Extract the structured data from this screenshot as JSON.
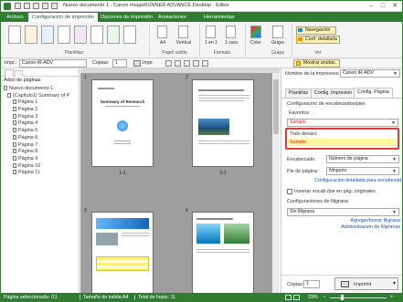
{
  "window": {
    "title": "Nuevo documento 1 - Canon imageRUNNER ADVANCE Desktop - Editor",
    "controls": [
      "–",
      "□",
      "✕"
    ]
  },
  "ribbon": {
    "tabs": [
      "Archivo",
      "Configuración de impresión",
      "Opciones de impresión",
      "Anotaciones",
      "Herramientas"
    ],
    "active_tab": 1,
    "groups": {
      "plantillas": "Plantillas",
      "papel_salida": "Papel salida",
      "formato": "Formato",
      "grapa": "Grapa",
      "ver": "Ver"
    },
    "buttons": {
      "a4": "A4",
      "vertical": "Vertical",
      "n_en_1": "1 en 1",
      "caras": "1 cara",
      "color": "Color",
      "grapa": "Grapa",
      "navegacion": "Navegación",
      "conf_detallada": "Conf. detallada"
    }
  },
  "toolbar": {
    "impr_label": "Impr.:",
    "printer": "Canon iR-ADV",
    "copias_label": "Copias:",
    "copias_value": "1",
    "print_label": "Impr.",
    "mostrar_anotac": "Mostrar anotac."
  },
  "left_pane": {
    "tree_title": "Árbol de páginas",
    "root": "Nuevo documento 1",
    "chapter": "(Capítulo1) Summary of P",
    "pages": [
      "Página 1",
      "Página 2",
      "Página 3",
      "Página 4",
      "Página 5",
      "Página 6",
      "Página 7",
      "Página 8",
      "Página 9",
      "Página 10",
      "Página 11"
    ]
  },
  "pages": [
    {
      "number": "1",
      "label": "1-1",
      "title": "Summary of Research"
    },
    {
      "number": "2",
      "label": "2-1"
    },
    {
      "number": "3"
    },
    {
      "number": "4"
    }
  ],
  "right_pane": {
    "printer_name_label": "Nombre de la impresora:",
    "printer_name": "Canon iR-ADV",
    "tabs": [
      "Plantillas",
      "Config. impresión",
      "Config. Página"
    ],
    "active_tab": 2,
    "header_footer_label": "Configuración de encabezados/pies",
    "favorites_label": "Favoritos",
    "favorites_value": "Sample",
    "dropdown_options": [
      "Todo desact.",
      "Sample"
    ],
    "selected_option": "Sample",
    "encabezado_label": "Encabezado:",
    "encabezado_value": "Número de página",
    "pie_label": "Pie de página:",
    "pie_value": "Ninguno",
    "detail_link": "Configuración detallada para encabezado/pie...",
    "insert_checkbox": "Insertar encab./pie en pág. originales",
    "watermark_label": "Configuraciones de filigrana",
    "watermark_value": "Sin filigrana",
    "add_watermark_link": "Agregar/borrar filigrana",
    "admin_watermark_link": "Administración de filigranas",
    "copies_label": "Copias:",
    "copies_value": "1",
    "print_button": "Imprimir"
  },
  "status": {
    "selected_page": "Página seleccionada: /11",
    "output_size": "Tamaño de salida:A4",
    "total_sheets": "Total de hojas: 11",
    "zoom": "29%"
  },
  "colors": {
    "accent_green": "#2e7d32",
    "highlight_red": "#e53935",
    "selected_yellow": "#fff59d",
    "link_blue": "#1c4fb0"
  }
}
